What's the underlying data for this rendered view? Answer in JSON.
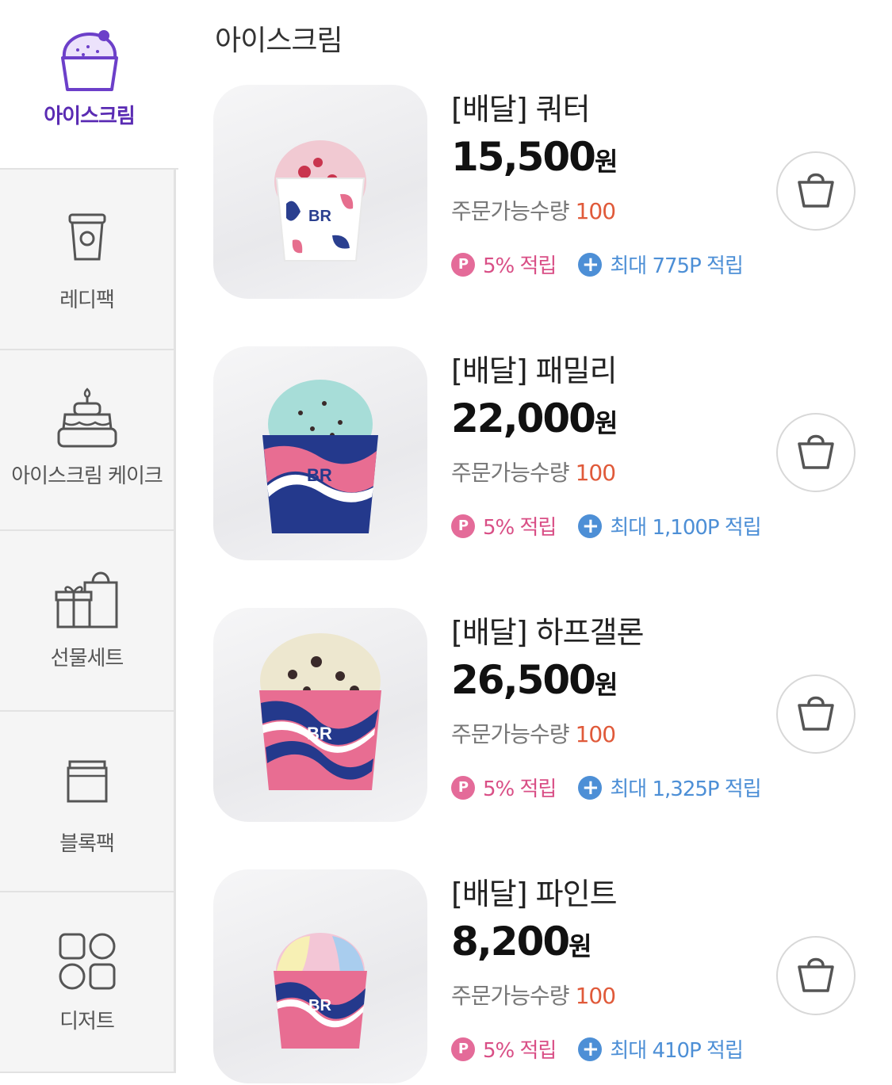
{
  "sidebar": {
    "items": [
      {
        "label": "아이스크림",
        "icon": "cupcake-icon",
        "active": true
      },
      {
        "label": "레디팩",
        "icon": "cup-icon"
      },
      {
        "label": "아이스크림 케이크",
        "icon": "cake-icon"
      },
      {
        "label": "선물세트",
        "icon": "gift-set-icon"
      },
      {
        "label": "블록팩",
        "icon": "block-pack-icon"
      },
      {
        "label": "디저트",
        "icon": "dessert-icon"
      }
    ]
  },
  "main": {
    "section_title": "아이스크림",
    "products": [
      {
        "name": "[배달] 쿼터",
        "price": "15,500",
        "currency": "원",
        "qty_label": "주문가능수량",
        "qty": "100",
        "point_rate": "5% 적립",
        "max_points": "최대 775P 적립",
        "image": "quarter-cup",
        "cream_color": "#f1c9d2"
      },
      {
        "name": "[배달] 패밀리",
        "price": "22,000",
        "currency": "원",
        "qty_label": "주문가능수량",
        "qty": "100",
        "point_rate": "5% 적립",
        "max_points": "최대 1,100P 적립",
        "image": "family-cup",
        "cream_color": "#a7ddd8"
      },
      {
        "name": "[배달] 하프갤론",
        "price": "26,500",
        "currency": "원",
        "qty_label": "주문가능수량",
        "qty": "100",
        "point_rate": "5% 적립",
        "max_points": "최대 1,325P 적립",
        "image": "half-gallon-cup",
        "cream_color": "#ede7cf"
      },
      {
        "name": "[배달] 파인트",
        "price": "8,200",
        "currency": "원",
        "qty_label": "주문가능수량",
        "qty": "100",
        "point_rate": "5% 적립",
        "max_points": "최대 410P 적립",
        "image": "pint-cup",
        "cream_color": "#f3c6d6"
      }
    ]
  },
  "colors": {
    "accent": "#5a2bb3",
    "pink": "#d94f86",
    "blue": "#4d8fd6",
    "qty": "#e05a3a"
  }
}
